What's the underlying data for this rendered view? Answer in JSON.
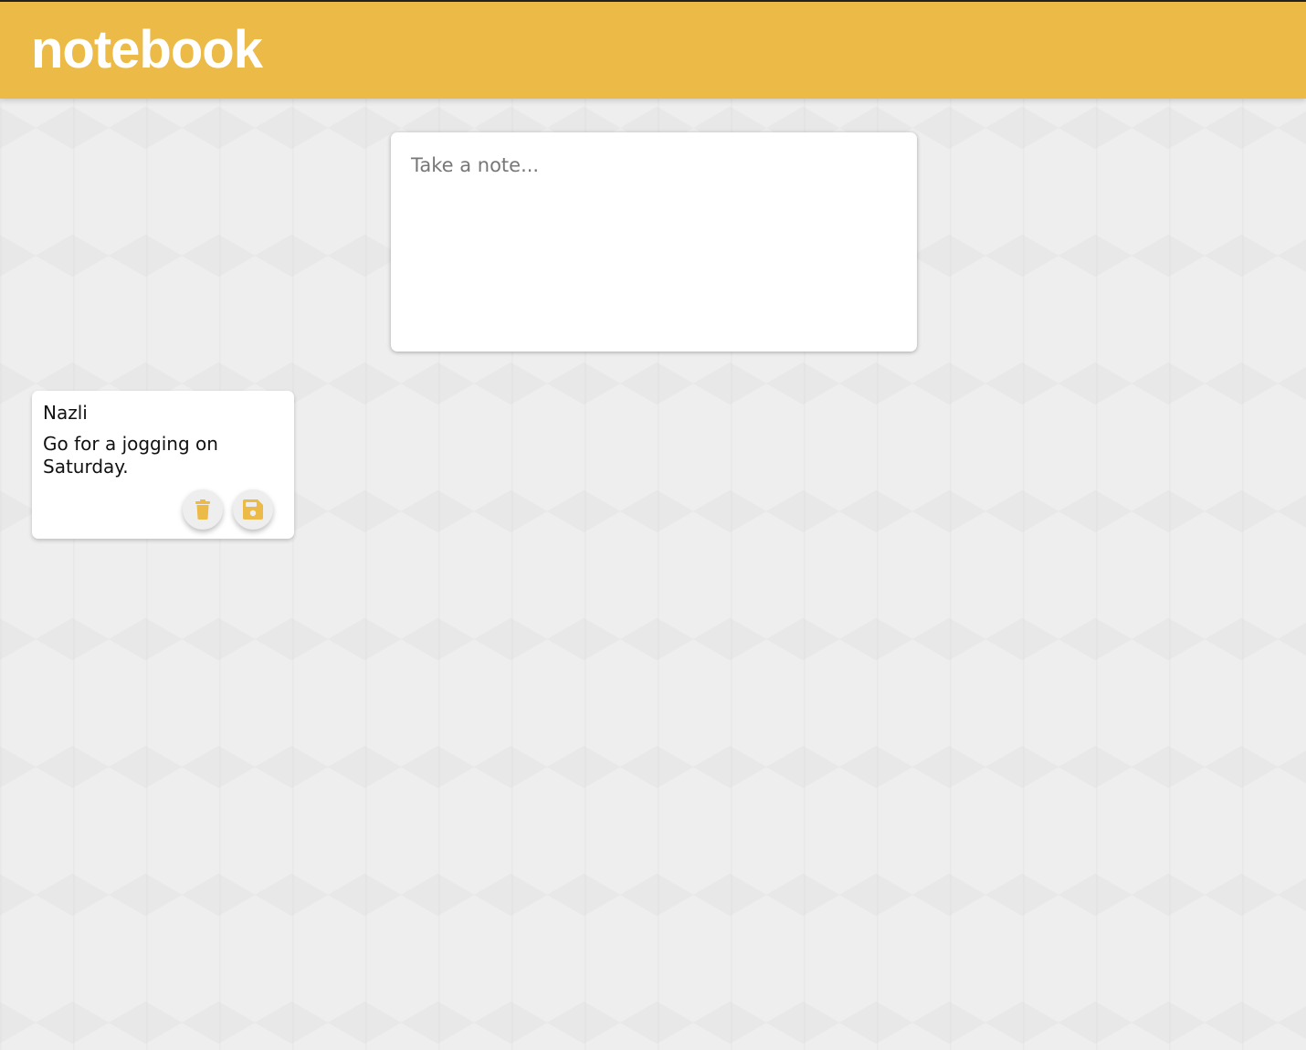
{
  "header": {
    "title": "notebook"
  },
  "compose": {
    "placeholder": "Take a note...",
    "value": ""
  },
  "notes": [
    {
      "title": "Nazli",
      "content": "Go for a jogging on Saturday.",
      "actions": [
        {
          "icon": "trash-icon",
          "label": "delete"
        },
        {
          "icon": "save-icon",
          "label": "save"
        }
      ]
    }
  ],
  "colors": {
    "accent": "#ebba47",
    "background": "#eeeeee",
    "card": "#ffffff"
  }
}
